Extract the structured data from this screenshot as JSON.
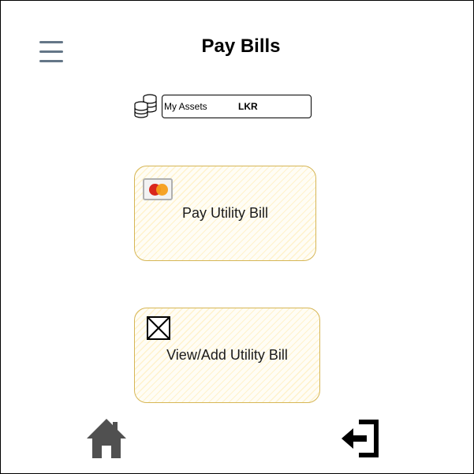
{
  "header": {
    "title": "Pay Bills",
    "menu_icon": "hamburger-menu-icon"
  },
  "assets": {
    "icon": "coins-icon",
    "label": "My Assets",
    "currency": "LKR"
  },
  "cards": {
    "pay_utility": {
      "label": "Pay Utility Bill",
      "icon": "credit-card-icon"
    },
    "view_add_utility": {
      "label": "View/Add Utility Bill",
      "icon": "image-placeholder-icon"
    }
  },
  "bottom_nav": {
    "home_icon": "home-icon",
    "logout_icon": "logout-icon"
  },
  "colors": {
    "card_fill": "#fff2cc",
    "card_border": "#d6b656",
    "menu_icon": "#647687",
    "nav_icon": "#505050"
  }
}
